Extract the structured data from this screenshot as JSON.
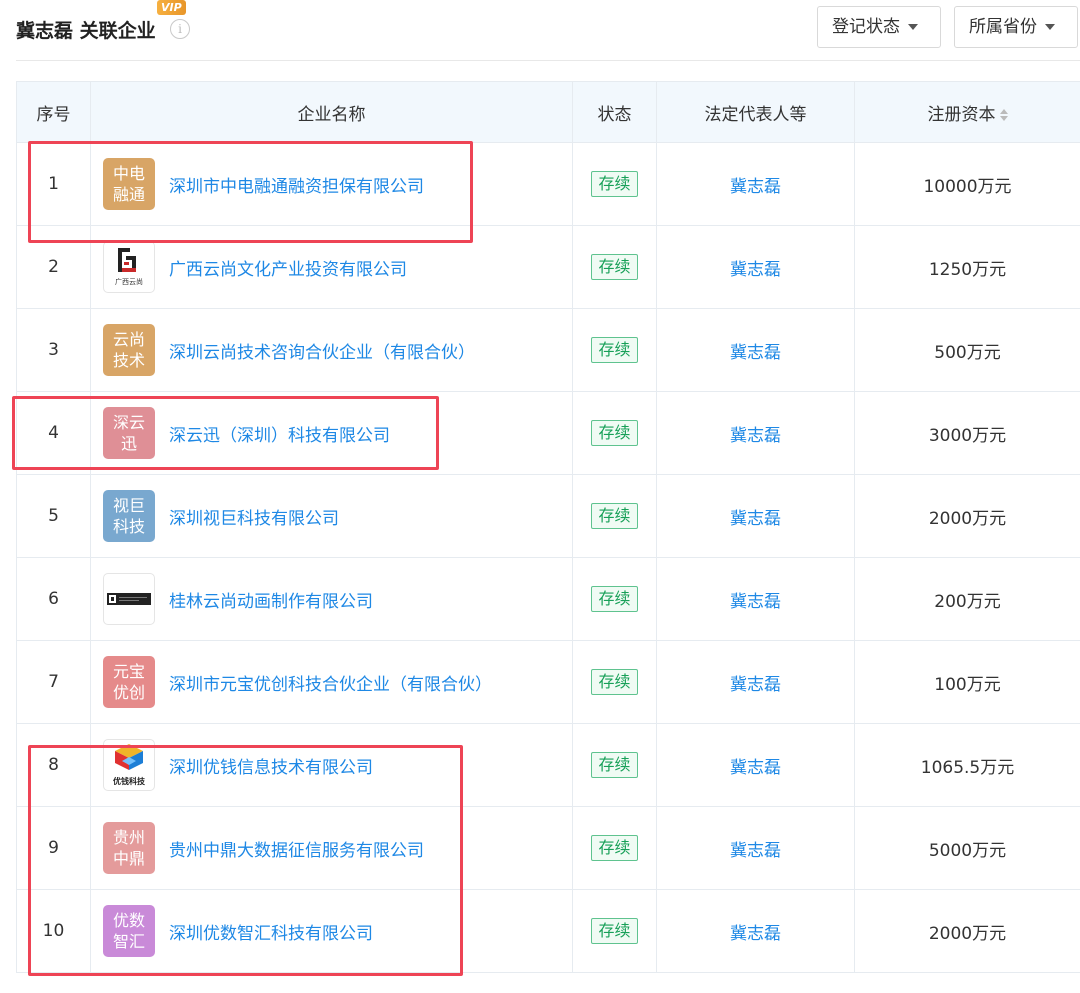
{
  "header": {
    "title": "冀志磊 关联企业",
    "vip": "VIP",
    "info_glyph": "i",
    "filter_status": "登记状态",
    "filter_province": "所属省份"
  },
  "columns": [
    "序号",
    "企业名称",
    "状态",
    "法定代表人等",
    "注册资本"
  ],
  "colors": {
    "link": "#1e88e5",
    "status_green": "#18a058",
    "highlight": "#ee4455"
  },
  "rows": [
    {
      "no": "1",
      "logo": "中电\n融通",
      "logo_color": "#d8a566",
      "name": "深圳市中电融通融资担保有限公司",
      "status": "存续",
      "rep": "冀志磊",
      "capital": "10000万元"
    },
    {
      "no": "2",
      "logo_icon": "guangxi-yunshang-logo",
      "logo_text": "广西云尚",
      "name": "广西云尚文化产业投资有限公司",
      "status": "存续",
      "rep": "冀志磊",
      "capital": "1250万元"
    },
    {
      "no": "3",
      "logo": "云尚\n技术",
      "logo_color": "#d8a566",
      "name": "深圳云尚技术咨询合伙企业（有限合伙）",
      "status": "存续",
      "rep": "冀志磊",
      "capital": "500万元"
    },
    {
      "no": "4",
      "logo": "深云\n迅",
      "logo_color": "#df8f96",
      "name": "深云迅（深圳）科技有限公司",
      "status": "存续",
      "rep": "冀志磊",
      "capital": "3000万元"
    },
    {
      "no": "5",
      "logo": "视巨\n科技",
      "logo_color": "#79a8cf",
      "name": "深圳视巨科技有限公司",
      "status": "存续",
      "rep": "冀志磊",
      "capital": "2000万元"
    },
    {
      "no": "6",
      "logo_icon": "guilin-yunshang-logo",
      "name": "桂林云尚动画制作有限公司",
      "status": "存续",
      "rep": "冀志磊",
      "capital": "200万元"
    },
    {
      "no": "7",
      "logo": "元宝\n优创",
      "logo_color": "#e58a8a",
      "name": "深圳市元宝优创科技合伙企业（有限合伙）",
      "status": "存续",
      "rep": "冀志磊",
      "capital": "100万元"
    },
    {
      "no": "8",
      "logo_icon": "youqian-tech-logo",
      "logo_text": "优钱科技",
      "name": "深圳优钱信息技术有限公司",
      "status": "存续",
      "rep": "冀志磊",
      "capital": "1065.5万元"
    },
    {
      "no": "9",
      "logo": "贵州\n中鼎",
      "logo_color": "#e49b9b",
      "name": "贵州中鼎大数据征信服务有限公司",
      "status": "存续",
      "rep": "冀志磊",
      "capital": "5000万元"
    },
    {
      "no": "10",
      "logo": "优数\n智汇",
      "logo_color": "#c98ad8",
      "name": "深圳优数智汇科技有限公司",
      "status": "存续",
      "rep": "冀志磊",
      "capital": "2000万元"
    }
  ]
}
